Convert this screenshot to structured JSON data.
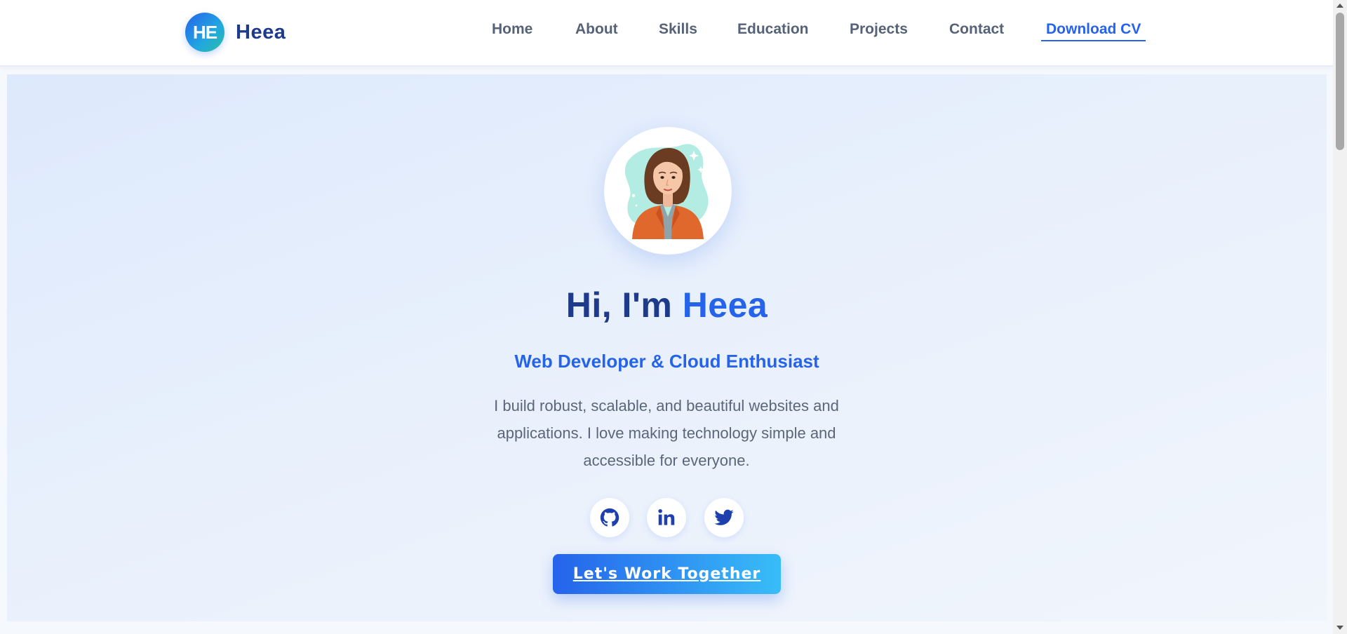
{
  "brand": {
    "logo_text": "HE",
    "name": "Heea"
  },
  "nav": {
    "items": [
      {
        "label": "Home"
      },
      {
        "label": "About"
      },
      {
        "label": "Skills"
      },
      {
        "label": "Education"
      },
      {
        "label": "Projects"
      },
      {
        "label": "Contact"
      }
    ],
    "cv_label": "Download CV"
  },
  "hero": {
    "greeting": "Hi, I'm ",
    "name": "Heea",
    "tagline": "Web Developer & Cloud Enthusiast",
    "bio": "I build robust, scalable, and beautiful websites and applications. I love making technology simple and accessible for everyone.",
    "cta_label": "Let's Work Together",
    "socials": [
      "github-icon",
      "linkedin-icon",
      "twitter-icon"
    ]
  },
  "colors": {
    "primary": "#2563eb",
    "navy": "#1e3a8a",
    "text_muted": "#5b6678",
    "cta_gradient_end": "#38bdf8"
  }
}
